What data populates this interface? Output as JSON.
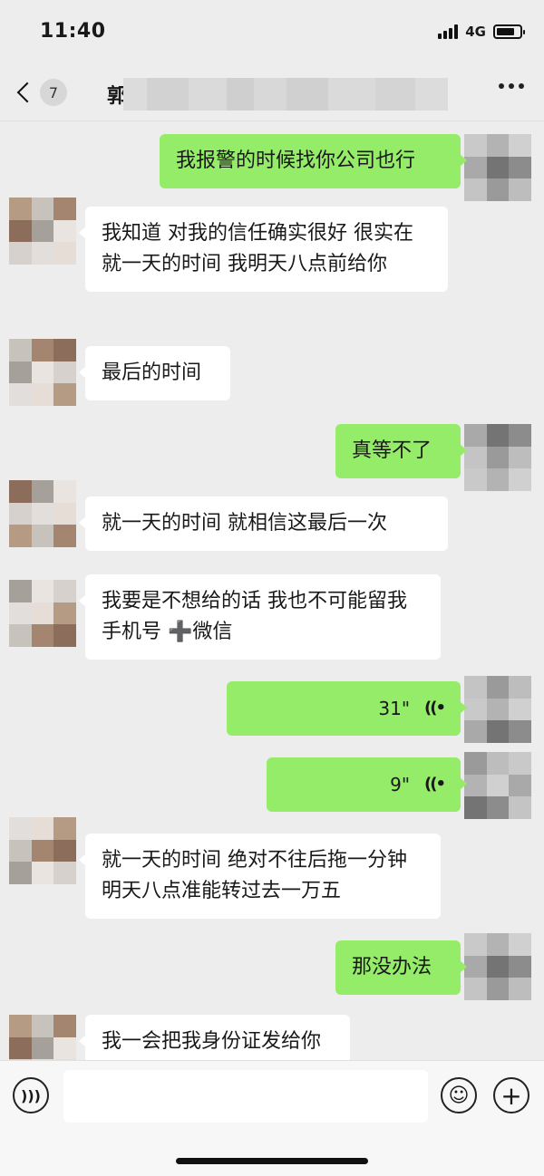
{
  "status": {
    "time": "11:40",
    "network": "4G",
    "battery_level": 0.8
  },
  "header": {
    "back_count": "7",
    "title_char": "郭",
    "more_icon": "ellipsis-icon"
  },
  "input_bar": {
    "voice_icon": "voice-mode-icon",
    "emoji_icon": "emoji-icon",
    "plus_icon": "plus-icon"
  },
  "messages": [
    {
      "side": "right",
      "type": "text",
      "text": "我报警的时候找你公司也行"
    },
    {
      "side": "left",
      "type": "text",
      "text": "我知道 对我的信任确实很好 很实在 就一天的时间 我明天八点前给你"
    },
    {
      "side": "left",
      "type": "text",
      "text": "最后的时间"
    },
    {
      "side": "right",
      "type": "text",
      "text": "真等不了"
    },
    {
      "side": "left",
      "type": "text",
      "text": "就一天的时间 就相信这最后一次"
    },
    {
      "side": "left",
      "type": "text",
      "text": "我要是不想给的话 我也不可能留我手机号 ➕微信"
    },
    {
      "side": "right",
      "type": "voice",
      "duration": "31\""
    },
    {
      "side": "right",
      "type": "voice",
      "duration": "9\""
    },
    {
      "side": "left",
      "type": "text",
      "text": "就一天的时间 绝对不往后拖一分钟 明天八点准能转过去一万五"
    },
    {
      "side": "right",
      "type": "text",
      "text": "那没办法"
    },
    {
      "side": "left",
      "type": "text",
      "text": "我一会把我身份证发给你"
    }
  ],
  "colors": {
    "bubble_sent": "#95ec69",
    "bubble_received": "#ffffff",
    "background": "#ededed"
  }
}
